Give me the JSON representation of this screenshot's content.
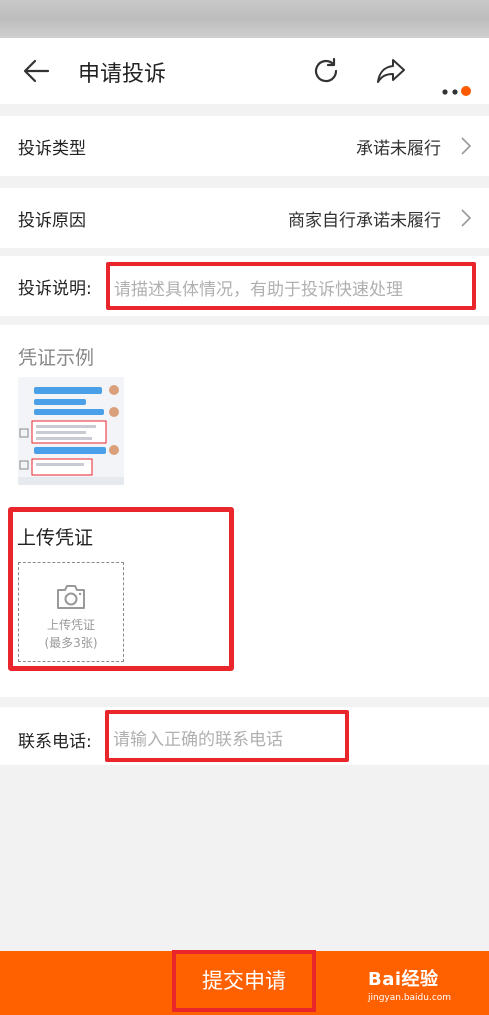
{
  "header": {
    "title": "申请投诉",
    "back_icon": "back-arrow-icon",
    "refresh_icon": "refresh-icon",
    "share_icon": "share-icon",
    "more_icon": "more-dots-icon",
    "badge_color": "#ff5a00"
  },
  "form": {
    "type": {
      "label": "投诉类型",
      "value": "承诺未履行"
    },
    "reason": {
      "label": "投诉原因",
      "value": "商家自行承诺未履行"
    },
    "description": {
      "label": "投诉说明:",
      "placeholder": "请描述具体情况，有助于投诉快速处理"
    },
    "sample": {
      "title": "凭证示例"
    },
    "upload": {
      "title": "上传凭证",
      "box_line1": "上传凭证",
      "box_line2": "(最多3张)",
      "icon": "camera-icon"
    },
    "phone": {
      "label": "联系电话:",
      "placeholder": "请输入正确的联系电话"
    }
  },
  "footer": {
    "submit_label": "提交申请",
    "watermark_main": "Bai经验",
    "watermark_sub": "jingyan.baidu.com",
    "bar_color": "#ff6000"
  },
  "colors": {
    "highlight": "#e8262c"
  }
}
